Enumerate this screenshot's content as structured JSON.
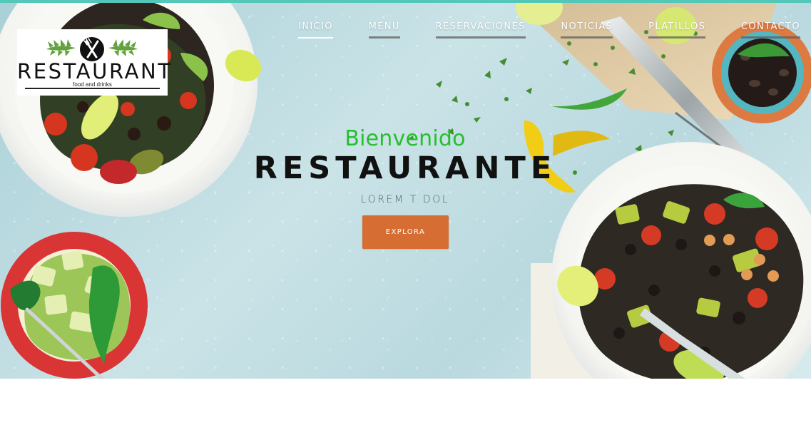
{
  "header": {
    "logo": {
      "name": "RESTAURANT",
      "tagline": "food and drinks"
    },
    "nav": [
      {
        "label": "INICIO",
        "active": true
      },
      {
        "label": "MENU",
        "active": false
      },
      {
        "label": "RESERVACIONES",
        "active": false
      },
      {
        "label": "NOTICIAS",
        "active": false
      },
      {
        "label": "PLATILLOS",
        "active": false
      },
      {
        "label": "CONTACTO",
        "active": false
      }
    ]
  },
  "hero": {
    "welcome": "Bienvenido",
    "title": "RESTAURANTE",
    "subtitle": "LOREM T DOL",
    "button_label": "EXPLORA"
  },
  "colors": {
    "top_line": "#53c7b8",
    "welcome_green": "#25bf2d",
    "button_orange": "#d66d32",
    "hero_blue": "#c8e2e7",
    "title_black": "#111111"
  },
  "icons": {
    "logo": "fork-knife-icon",
    "left_leaf": "leaf-branch-icon",
    "right_leaf": "leaf-branch-icon"
  }
}
